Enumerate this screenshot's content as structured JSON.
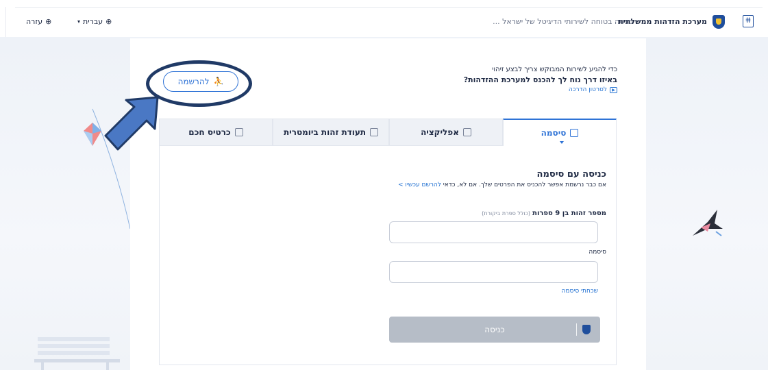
{
  "header": {
    "brand_name": "מערכת הזדהות ממשלתית",
    "brand_sub": "... כניסה בטוחה לשירותי הדיגיטל של ישראל",
    "language": "עברית",
    "help": "עזרה"
  },
  "intro": {
    "line1": "כדי להגיע לשירות המבוקש צריך לבצע זיהוי",
    "line2": "באיזו דרך נוח לך להכנס למערכת ההזדהות?",
    "tutorial": "לסרטון הדרכה"
  },
  "register_button": "להרשמה",
  "tabs": [
    {
      "label": "סיסמה",
      "icon": "lock-icon",
      "active": true
    },
    {
      "label": "אפליקציה",
      "icon": "phone-icon",
      "active": false
    },
    {
      "label": "תעודת זהות ביומטרית",
      "icon": "id-card-icon",
      "active": false
    },
    {
      "label": "כרטיס חכם",
      "icon": "smart-card-icon",
      "active": false
    }
  ],
  "login": {
    "title": "כניסה עם סיסמה",
    "subtitle_text": "אם כבר נרשמת אפשר להכניס את הפרטים שלך. אם לא, כדאי",
    "subtitle_link": "להרשם עכשיו >",
    "id_label": "מספר זהות בן 9 ספרות",
    "id_hint": "(כולל ספרת ביקורת)",
    "password_label": "סיסמה",
    "forgot_password": "שכחתי סיסמה",
    "submit": "כניסה"
  },
  "colors": {
    "accent": "#2f73d6",
    "brand": "#1f4e9c",
    "annotation": "#203a66",
    "button_disabled": "#b6bdc7"
  }
}
